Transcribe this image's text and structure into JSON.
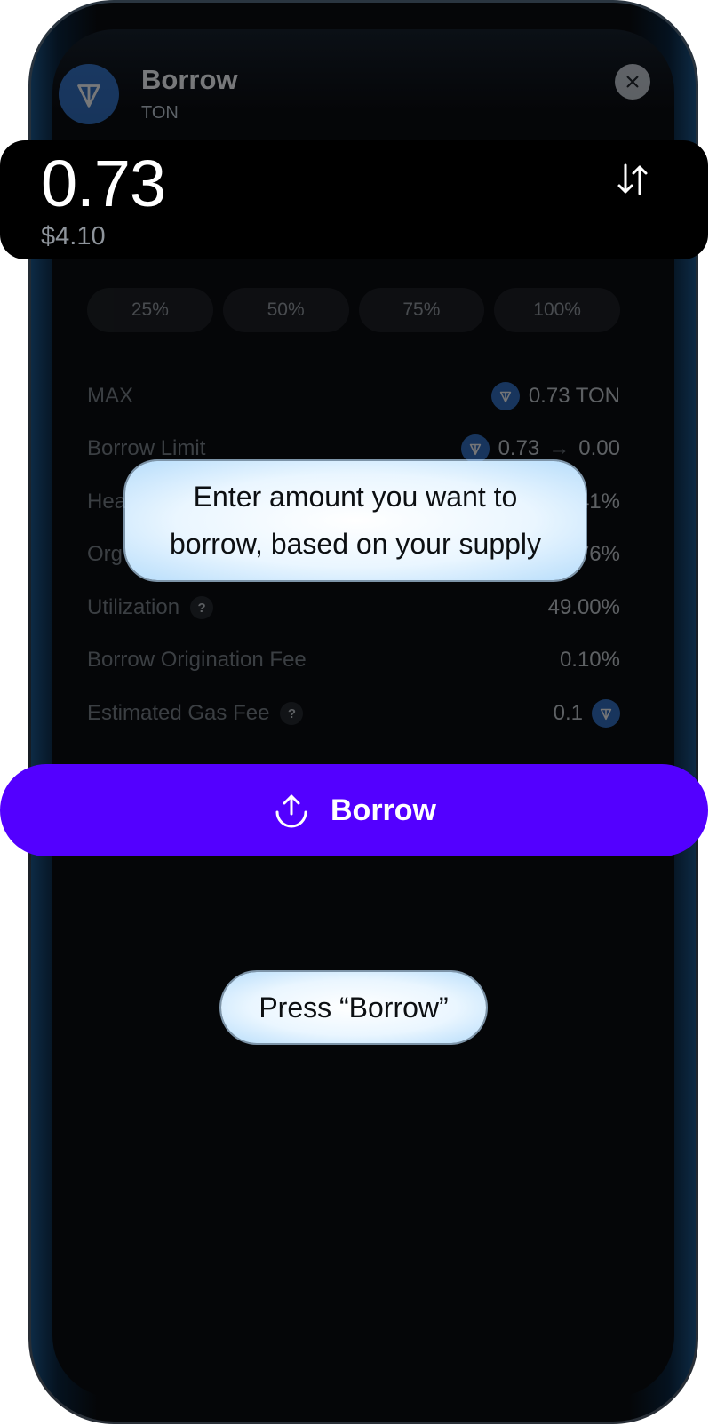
{
  "header": {
    "title": "Borrow",
    "subtitle": "TON"
  },
  "amount": {
    "value": "0.73",
    "usd": "$4.10"
  },
  "percent_buttons": [
    "25%",
    "50%",
    "75%",
    "100%"
  ],
  "info": {
    "max": {
      "label": "MAX",
      "value": "0.73 TON"
    },
    "borrow_limit": {
      "label": "Borrow Limit",
      "from": "0.73",
      "arrow": "→",
      "to": "0.00"
    },
    "health": {
      "label_visible": "Hea",
      "value_visible": "41%"
    },
    "origination": {
      "label_visible": "Org",
      "value_visible": "76%"
    },
    "utilization": {
      "label": "Utilization",
      "help": "?",
      "value": "49.00%"
    },
    "borrow_fee": {
      "label": "Borrow Origination Fee",
      "value": "0.10%"
    },
    "gas_fee": {
      "label": "Estimated Gas Fee",
      "help": "?",
      "value": "0.1"
    }
  },
  "borrow_button": {
    "label": "Borrow"
  },
  "tooltips": {
    "amount_hint_line1": "Enter amount you want to",
    "amount_hint_line2": "borrow, based on your supply",
    "press_hint": "Press “Borrow”"
  },
  "colors": {
    "accent": "#5300ff",
    "ton_blue": "#2f6fc4",
    "background": "#050608"
  },
  "icons": {
    "token": "ton-icon",
    "close": "close-icon",
    "swap": "swap-arrows-icon",
    "borrow": "upload-arrow-icon"
  }
}
